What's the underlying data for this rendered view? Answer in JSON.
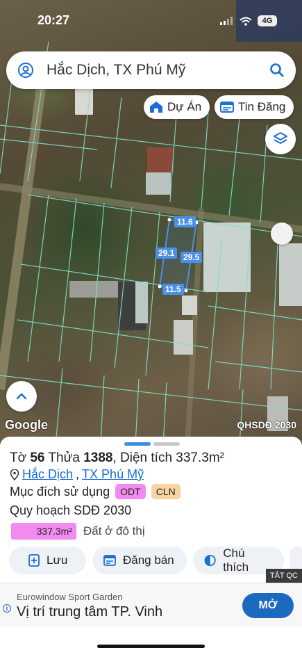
{
  "status_bar": {
    "time": "20:27",
    "network": "4G"
  },
  "search": {
    "text": "Hắc Dịch, TX Phú Mỹ"
  },
  "chips": [
    {
      "label": "Dự Án"
    },
    {
      "label": "Tin Đăng"
    }
  ],
  "map": {
    "attribution": "Google",
    "layer_label": "QHSDĐ 2030",
    "dimensions": [
      "11.6",
      "29.1",
      "29.5",
      "11.5"
    ],
    "colors": {
      "parcel_lines": "#7fe0c8",
      "selected_parcel": "#4a8fe8"
    }
  },
  "sheet": {
    "sheet_prefix": "Tờ",
    "sheet_no": "56",
    "plot_prefix": "Thửa",
    "plot_no": "1388",
    "area_text": ", Diện tích 337.3m²",
    "address": {
      "ward": "Hắc Dịch",
      "separator": ",",
      "town": "TX Phú Mỹ"
    },
    "purpose_label": "Mục đích sử dụng",
    "tags": [
      {
        "label": "ODT",
        "color": "#f28bf0"
      },
      {
        "label": "CLN",
        "color": "#f6d3a0"
      }
    ],
    "plan_label": "Quy hoạch SDĐ 2030",
    "plan_area": "337.3m²",
    "plan_desc": "Đất ở đô thị",
    "actions": [
      {
        "label": "Lưu"
      },
      {
        "label": "Đăng bán"
      },
      {
        "label": "Chú thích"
      }
    ],
    "handle_colors": [
      "#3b8fe0",
      "#c8c8c8"
    ]
  },
  "ad": {
    "tag": "TẮT QC",
    "advertiser": "Eurowindow Sport Garden",
    "headline": "Vị trí trung tâm TP. Vinh",
    "cta": "MỞ"
  }
}
